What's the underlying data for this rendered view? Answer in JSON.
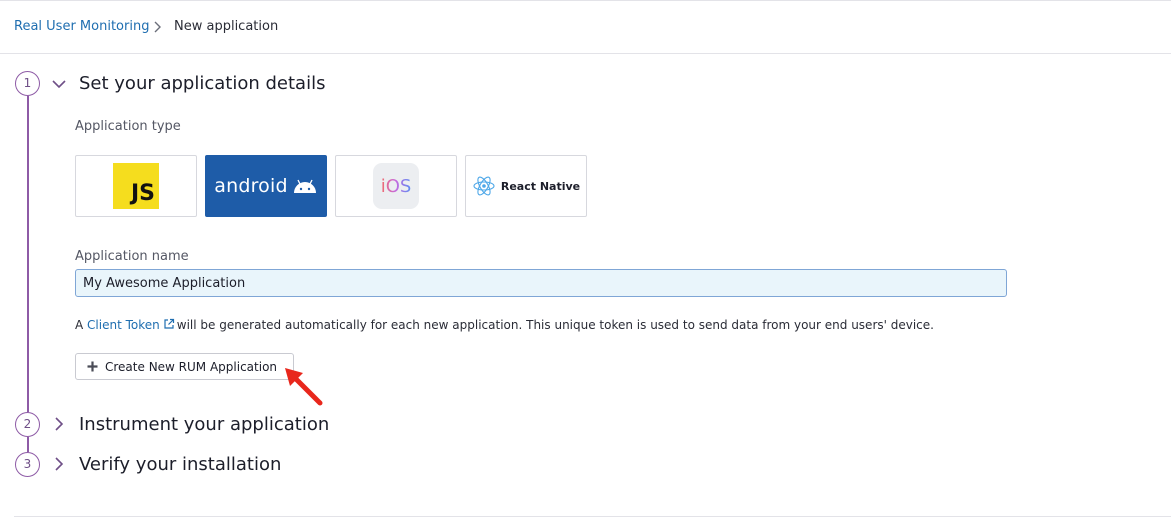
{
  "breadcrumb": {
    "parent": "Real User Monitoring",
    "current": "New application"
  },
  "steps": [
    {
      "number": "1",
      "title": "Set your application details",
      "expanded": true
    },
    {
      "number": "2",
      "title": "Instrument your application",
      "expanded": false
    },
    {
      "number": "3",
      "title": "Verify your installation",
      "expanded": false
    }
  ],
  "app_type": {
    "label": "Application type",
    "options": [
      {
        "id": "js",
        "text": "JS",
        "selected": false
      },
      {
        "id": "android",
        "text": "android",
        "selected": true
      },
      {
        "id": "ios",
        "text": "iOS",
        "selected": false
      },
      {
        "id": "react-native",
        "text": "React Native",
        "selected": false
      }
    ]
  },
  "app_name": {
    "label": "Application name",
    "value": "My Awesome Application"
  },
  "info": {
    "prefix": "A",
    "link": "Client Token",
    "suffix": "will be generated automatically for each new application. This unique token is used to send data from your end users' device."
  },
  "create_button": {
    "label": "Create New RUM Application"
  },
  "colors": {
    "accent_purple": "#8e5ba6",
    "link_blue": "#1f6eb0",
    "selected_tile": "#1e5ca8",
    "annotation_arrow": "#e8271c"
  }
}
